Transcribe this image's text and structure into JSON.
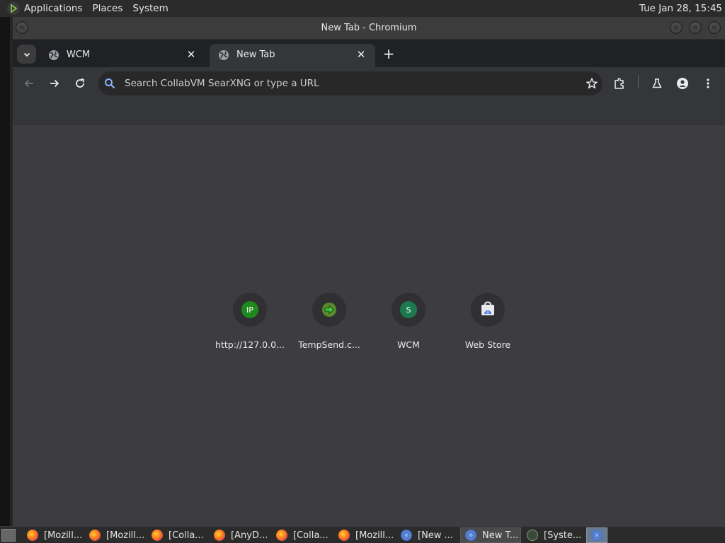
{
  "top_panel": {
    "menus": [
      "Applications",
      "Places",
      "System"
    ],
    "clock": "Tue Jan 28, 15:45"
  },
  "window": {
    "title": "New Tab - Chromium"
  },
  "tabs": [
    {
      "label": "WCM",
      "active": false
    },
    {
      "label": "New Tab",
      "active": true
    }
  ],
  "omnibox": {
    "placeholder": "Search CollabVM SearXNG or type a URL"
  },
  "shortcuts": [
    {
      "label": "http://127.0.0...",
      "icon": "IP"
    },
    {
      "label": "TempSend.c...",
      "icon": "arrow"
    },
    {
      "label": "WCM",
      "icon": "S"
    },
    {
      "label": "Web Store",
      "icon": "webstore"
    }
  ],
  "taskbar": {
    "items": [
      {
        "label": "[Mozill...",
        "icon": "firefox",
        "active": false
      },
      {
        "label": "[Mozill...",
        "icon": "firefox",
        "active": false
      },
      {
        "label": "[Colla...",
        "icon": "firefox",
        "active": false
      },
      {
        "label": "[AnyD...",
        "icon": "firefox",
        "active": false
      },
      {
        "label": "[Colla...",
        "icon": "firefox",
        "active": false
      },
      {
        "label": "[Mozill...",
        "icon": "firefox",
        "active": false
      },
      {
        "label": "[New ...",
        "icon": "chromium",
        "active": false
      },
      {
        "label": "New T...",
        "icon": "chromium",
        "active": true
      },
      {
        "label": "[Syste...",
        "icon": "system-monitor",
        "active": false
      }
    ]
  },
  "colors": {
    "content_bg": "#3c3c41",
    "toolbar_bg": "#35363a",
    "tabstrip_bg": "#202124",
    "accent_blue": "#8ab4f8"
  }
}
